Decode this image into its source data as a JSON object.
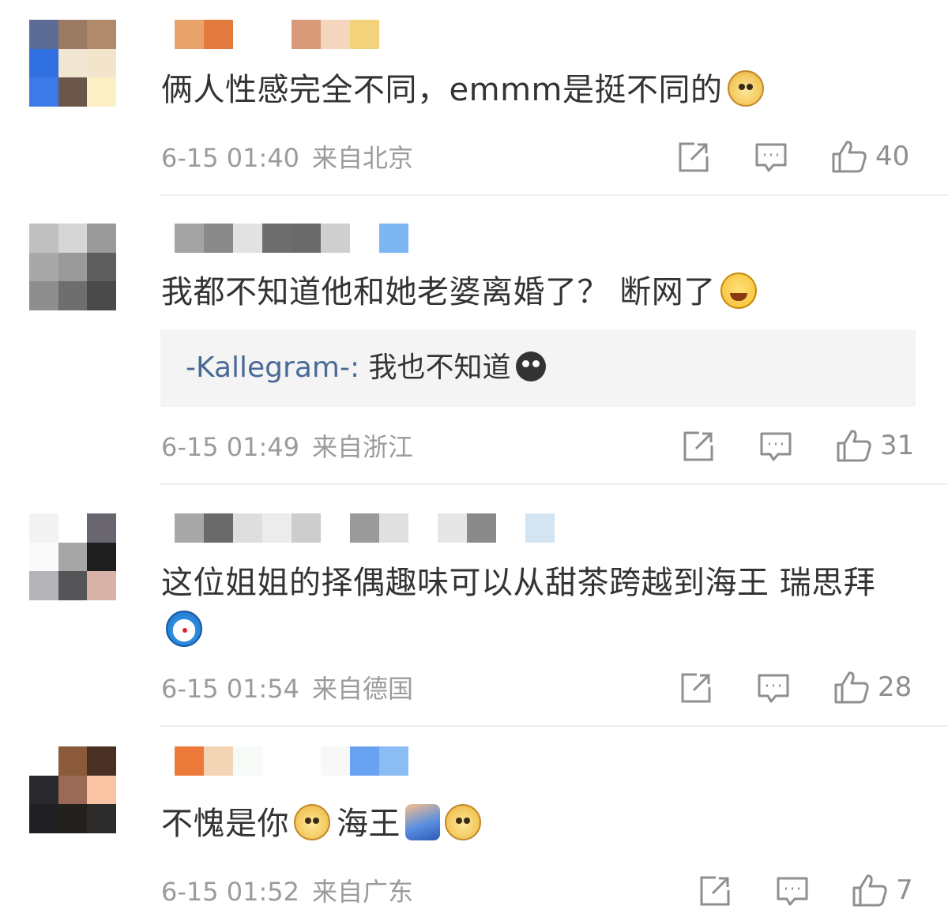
{
  "comments": [
    {
      "avatar_colors": [
        "#5d6c96",
        "#9a7a62",
        "#b08a6a",
        "#2f6fe0",
        "#f0e6d2",
        "#f3e4cc",
        "#3d7ae8",
        "#6a564a",
        "#fbf0c4"
      ],
      "username_colors": [
        "#e9a26a",
        "#e27a3e",
        "#ffffff",
        "#ffffff",
        "#d99a7a",
        "#f3d6bd",
        "#f2d27a"
      ],
      "text": "俩人性感完全不同，emmm是挺不同的",
      "emoji": "doge-icon",
      "time": "6-15 01:40",
      "location": "来自北京",
      "likes": "40"
    },
    {
      "avatar_colors": [
        "#c0c0c0",
        "#d6d6d6",
        "#9a9a9a",
        "#a8a8a8",
        "#9a9a9a",
        "#5e5e5e",
        "#8e8e8e",
        "#6e6e6e",
        "#4a4a4a"
      ],
      "username_colors": [
        "#a4a4a4",
        "#8a8a8a",
        "#e2e2e2",
        "#6e6e6e",
        "#6a6a6a",
        "#cfcfcf",
        "#ffffff",
        "#7db6f3"
      ],
      "text": "我都不知道他和她老婆离婚了？ 断网了",
      "emoji": "laughing-crying-icon",
      "reply": {
        "user": "-Kallegram-",
        "separator": ": ",
        "text": "我也不知道",
        "emoji": "crying-face-icon"
      },
      "time": "6-15 01:49",
      "location": "来自浙江",
      "likes": "31"
    },
    {
      "avatar_colors": [
        "#f2f2f2",
        "#ffffff",
        "#6a6670",
        "#fafafa",
        "#a6a6a6",
        "#1e1e1e",
        "#b4b4b8",
        "#555558",
        "#d8b2a8"
      ],
      "username_colors": [
        "#a8a8a8",
        "#6a6a6a",
        "#dedede",
        "#ececec",
        "#cdcdcd",
        "#ffffff",
        "#9a9a9a",
        "#e0e0e0",
        "#ffffff",
        "#e6e6e6",
        "#8a8a8a",
        "#ffffff",
        "#d4e4f0"
      ],
      "text": "这位姐姐的择偶趣味可以从甜茶跨越到海王 瑞思拜",
      "emoji": "doraemon-icon",
      "time": "6-15 01:54",
      "location": "来自德国",
      "likes": "28"
    },
    {
      "avatar_colors": [
        "#ffffff",
        "#8a5a3a",
        "#4a3024",
        "#2a2a2e",
        "#9a6a56",
        "#f8c4a4",
        "#202024",
        "#24201e",
        "#2c2c2c"
      ],
      "username_colors": [
        "#ec7a3a",
        "#f3d4b4",
        "#f7fbf8",
        "#ffffff",
        "#ffffff",
        "#f8f8f8",
        "#6aa2f2",
        "#8cbcf4"
      ],
      "text_parts": [
        "不愧是你",
        "海王"
      ],
      "emojis": [
        "doge-icon",
        "mermaid-icon",
        "doge-icon"
      ],
      "time": "6-15 01:52",
      "location": "来自广东",
      "likes": "7"
    }
  ],
  "icons": {
    "share": "share-icon",
    "reply": "comment-icon",
    "like": "thumbs-up-icon"
  }
}
